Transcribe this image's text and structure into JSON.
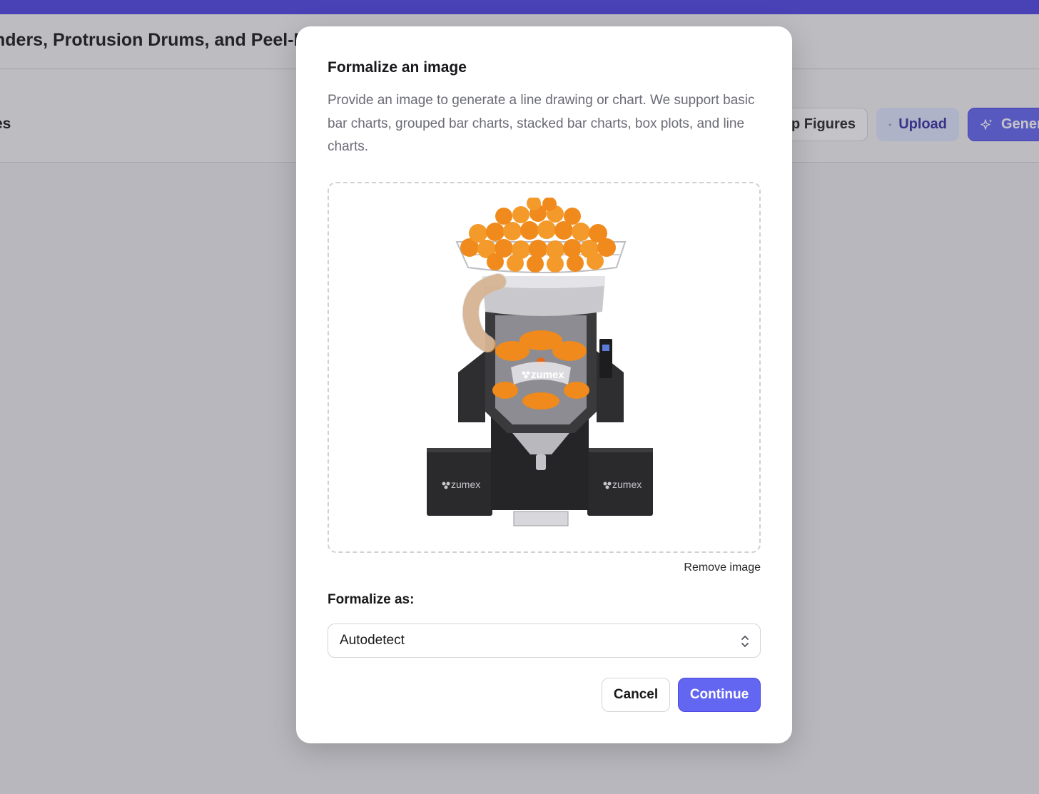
{
  "app": {
    "document_title": "nders, Protrusion Drums, and Peel-E",
    "section_title": "es",
    "toolbar": {
      "figures_label": "up Figures",
      "upload_label": "Upload",
      "generate_label": "Gener"
    }
  },
  "modal": {
    "title": "Formalize an image",
    "description": "Provide an image to generate a line drawing or chart. We support basic bar charts, grouped bar charts, stacked bar charts, box plots, and line charts.",
    "image": {
      "subject": "orange-juicer-machine",
      "brand_text": "zumex"
    },
    "remove_label": "Remove image",
    "field_label": "Formalize as:",
    "select_value": "Autodetect",
    "cancel_label": "Cancel",
    "continue_label": "Continue"
  },
  "colors": {
    "accent": "#6366f1",
    "topbar": "#4f46e5",
    "orange": "#f08a1c",
    "machine_dark": "#2a2a2c"
  }
}
